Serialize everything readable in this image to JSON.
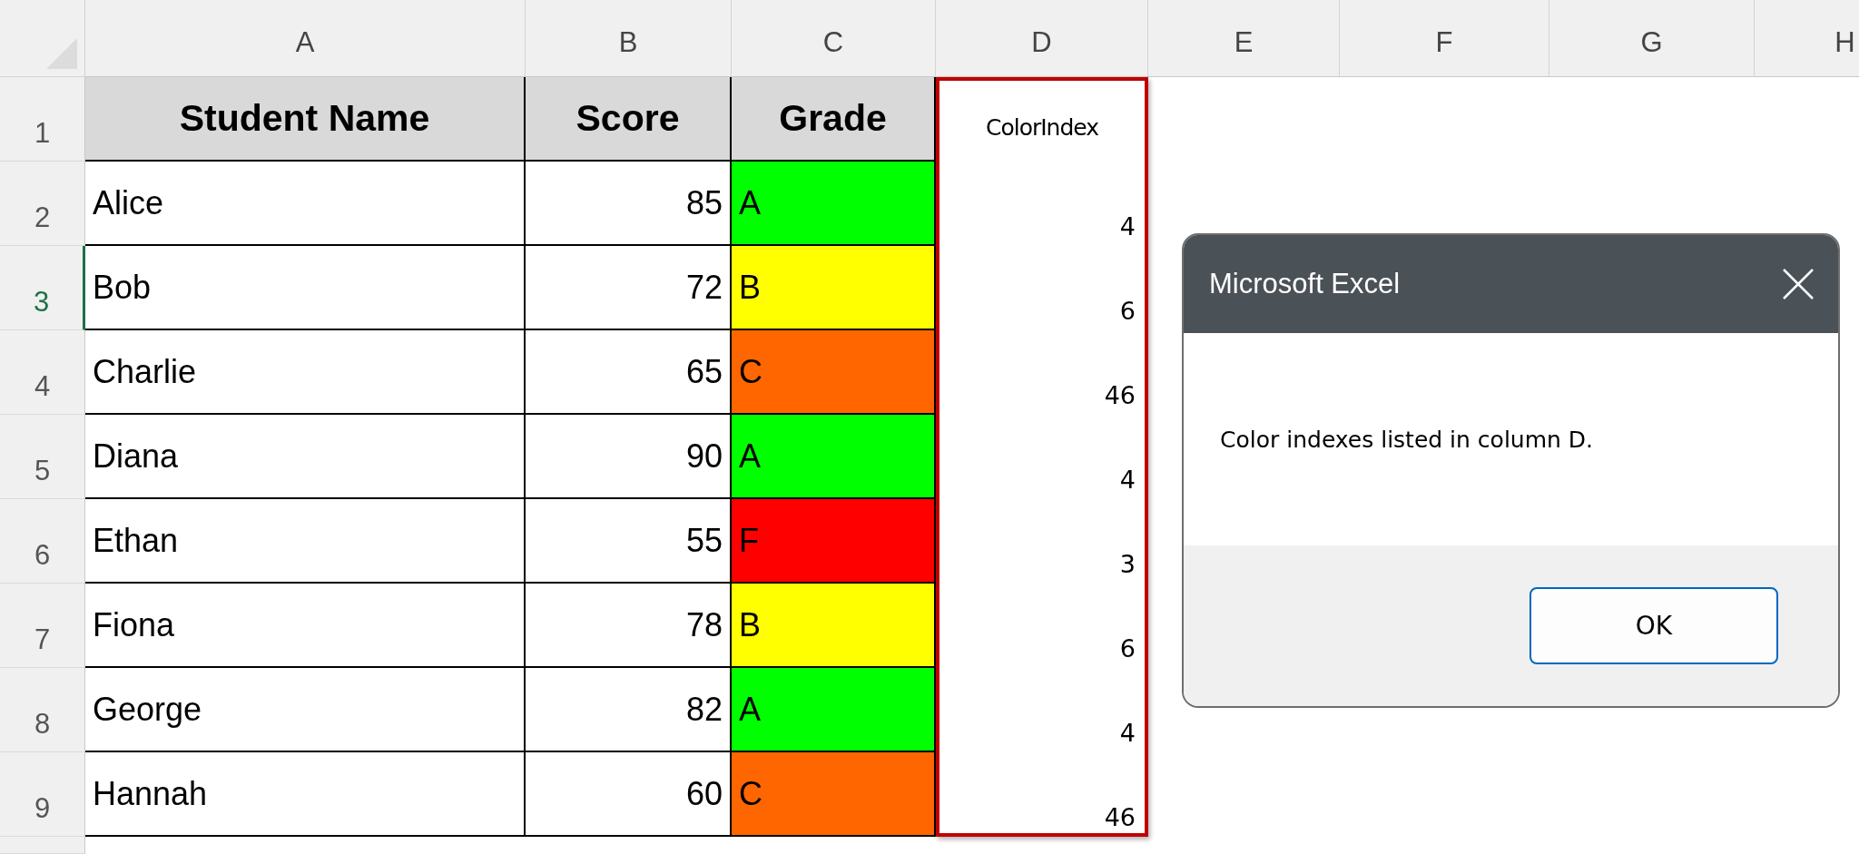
{
  "columns": [
    {
      "label": "A",
      "highlighted": false
    },
    {
      "label": "B",
      "highlighted": false
    },
    {
      "label": "C",
      "highlighted": false
    },
    {
      "label": "D",
      "highlighted": true
    },
    {
      "label": "E",
      "highlighted": false
    },
    {
      "label": "F",
      "highlighted": false
    },
    {
      "label": "G",
      "highlighted": false
    },
    {
      "label": "H",
      "highlighted": false
    }
  ],
  "table": {
    "header": {
      "number": "1",
      "selected": false,
      "name": "Student Name",
      "score": "Score",
      "grade": "Grade",
      "color_index": "ColorIndex"
    },
    "rows": [
      {
        "number": "2",
        "selected": false,
        "name": "Alice",
        "score": "85",
        "grade": "A",
        "color": "#00ff00",
        "color_index": "4"
      },
      {
        "number": "3",
        "selected": true,
        "name": "Bob",
        "score": "72",
        "grade": "B",
        "color": "#ffff00",
        "color_index": "6"
      },
      {
        "number": "4",
        "selected": false,
        "name": "Charlie",
        "score": "65",
        "grade": "C",
        "color": "#ff6600",
        "color_index": "46"
      },
      {
        "number": "5",
        "selected": false,
        "name": "Diana",
        "score": "90",
        "grade": "A",
        "color": "#00ff00",
        "color_index": "4"
      },
      {
        "number": "6",
        "selected": false,
        "name": "Ethan",
        "score": "55",
        "grade": "F",
        "color": "#ff0000",
        "color_index": "3"
      },
      {
        "number": "7",
        "selected": false,
        "name": "Fiona",
        "score": "78",
        "grade": "B",
        "color": "#ffff00",
        "color_index": "6"
      },
      {
        "number": "8",
        "selected": false,
        "name": "George",
        "score": "82",
        "grade": "A",
        "color": "#00ff00",
        "color_index": "4"
      },
      {
        "number": "9",
        "selected": false,
        "name": "Hannah",
        "score": "60",
        "grade": "C",
        "color": "#ff6600",
        "color_index": "46"
      }
    ]
  },
  "dialog": {
    "title": "Microsoft Excel",
    "message": "Color indexes listed in column D.",
    "buttons": [
      "OK"
    ]
  }
}
